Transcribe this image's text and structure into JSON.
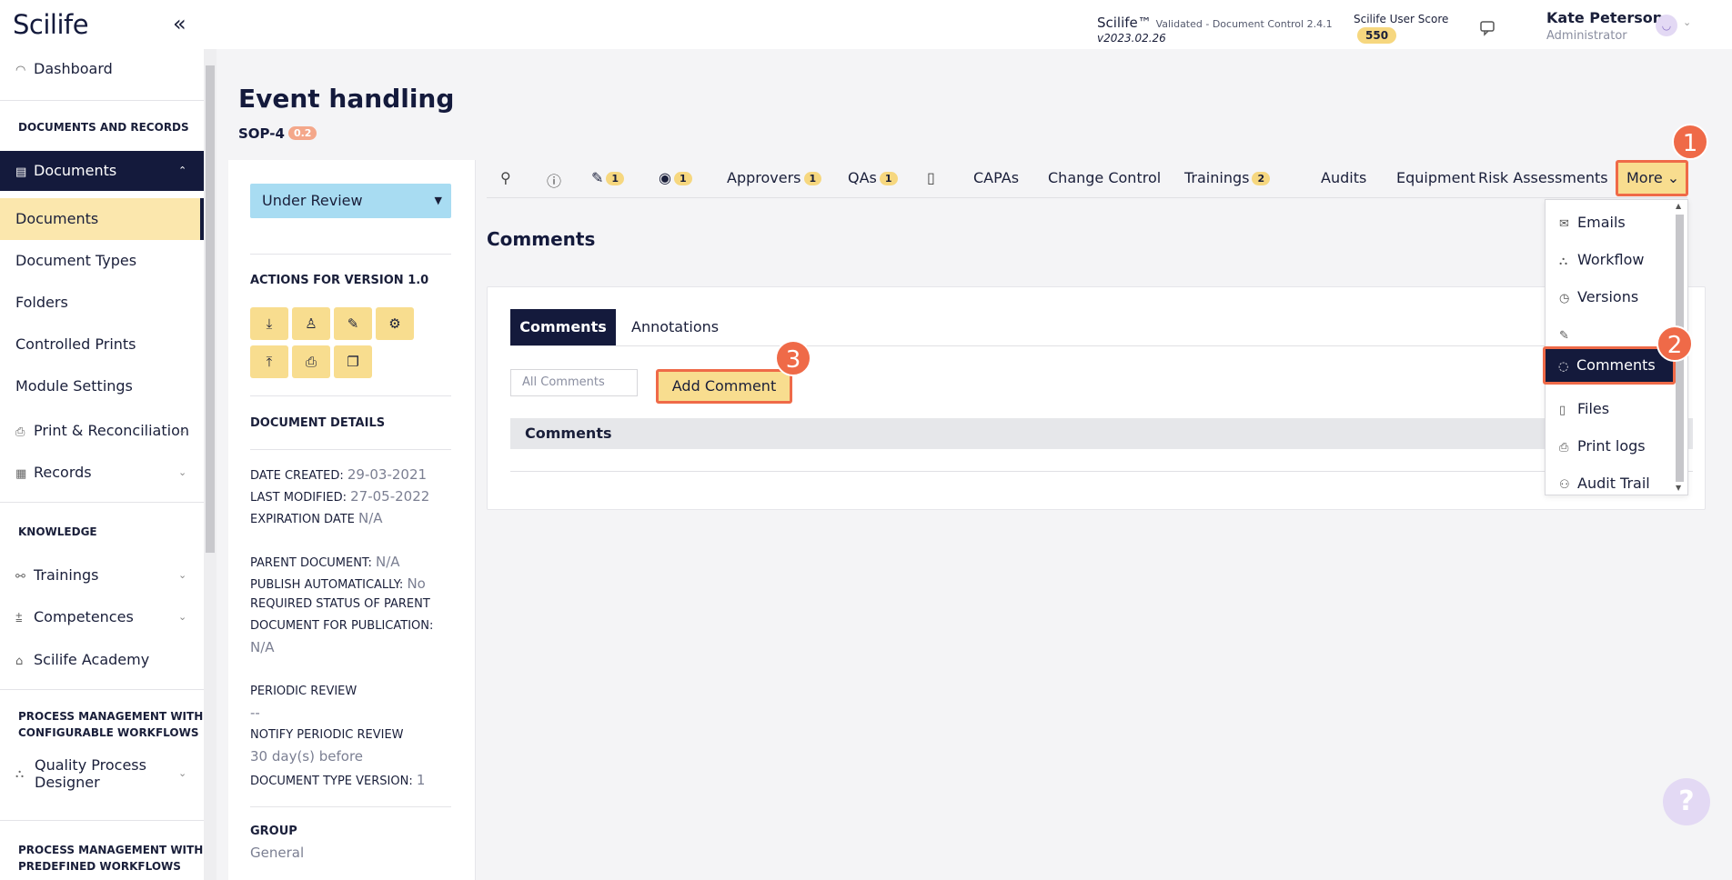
{
  "topbar": {
    "logo": "Scilife",
    "collapse_icon": "double-chevron-left",
    "app_name": "Scilife™",
    "app_status": "Validated - Document Control 2.4.1",
    "version": "v2023.02.26",
    "score_label": "Scilife User Score",
    "score_value": "550",
    "user_name": "Kate Peterson",
    "user_role": "Administrator"
  },
  "sidebar": {
    "dashboard": "Dashboard",
    "section_docs": "DOCUMENTS AND RECORDS",
    "documents": "Documents",
    "sub_items": [
      "Documents",
      "Document Types",
      "Folders",
      "Controlled Prints",
      "Module Settings"
    ],
    "print_rec": "Print & Reconciliation",
    "records": "Records",
    "section_knowledge": "KNOWLEDGE",
    "trainings": "Trainings",
    "competences": "Competences",
    "academy": "Scilife Academy",
    "section_process_conf": "PROCESS MANAGEMENT WITH CONFIGURABLE WORKFLOWS",
    "section_process_conf_l1": "PROCESS MANAGEMENT WITH",
    "section_process_conf_l2": "CONFIGURABLE WORKFLOWS",
    "qpd_l1": "Quality Process",
    "qpd_l2": "Designer",
    "section_process_pre_l1": "PROCESS MANAGEMENT WITH",
    "section_process_pre_l2": "PREDEFINED WORKFLOWS"
  },
  "page": {
    "title": "Event handling",
    "code": "SOP-4",
    "version_badge": "0.2"
  },
  "details": {
    "status": "Under Review",
    "actions_title": "ACTIONS FOR VERSION 1.0",
    "details_title": "DOCUMENT DETAILS",
    "date_created_label": "DATE CREATED:",
    "date_created": "29-03-2021",
    "last_modified_label": "LAST MODIFIED:",
    "last_modified": "27-05-2022",
    "expiration_label": "EXPIRATION DATE",
    "expiration": "N/A",
    "parent_label": "PARENT DOCUMENT:",
    "parent": "N/A",
    "publish_label": "PUBLISH AUTOMATICALLY:",
    "publish": "No",
    "required_l1": "REQUIRED STATUS OF PARENT",
    "required_l2": "DOCUMENT FOR PUBLICATION:",
    "required": "N/A",
    "periodic_label": "PERIODIC REVIEW",
    "periodic": "--",
    "notify_label": "NOTIFY PERIODIC REVIEW",
    "notify": "30 day(s) before",
    "doctype_label": "DOCUMENT TYPE VERSION:",
    "doctype": "1",
    "group_label": "GROUP",
    "group": "General"
  },
  "tabs": {
    "edit_count": "1",
    "view_count": "1",
    "approvers": "Approvers",
    "approvers_count": "1",
    "qas": "QAs",
    "qas_count": "1",
    "capas": "CAPAs",
    "change_control": "Change Control",
    "trainings": "Trainings",
    "trainings_count": "2",
    "audits": "Audits",
    "equipment": "Equipment",
    "risk": "Risk Assessments",
    "more": "More"
  },
  "comments": {
    "title": "Comments",
    "tab_comments": "Comments",
    "tab_annotations": "Annotations",
    "filter": "All Comments",
    "add": "Add Comment",
    "table_header": "Comments"
  },
  "dropdown": {
    "emails": "Emails",
    "workflow": "Workflow",
    "versions": "Versions",
    "comments": "Comments",
    "files": "Files",
    "print_logs": "Print logs",
    "audit_trail": "Audit Trail"
  },
  "steps": [
    "1",
    "2",
    "3"
  ],
  "help": "?",
  "colors": {
    "navy": "#141a3c",
    "accent_yellow": "#f8dd8f",
    "highlight": "#ef6a48",
    "status_blue": "#a8dcf2"
  }
}
